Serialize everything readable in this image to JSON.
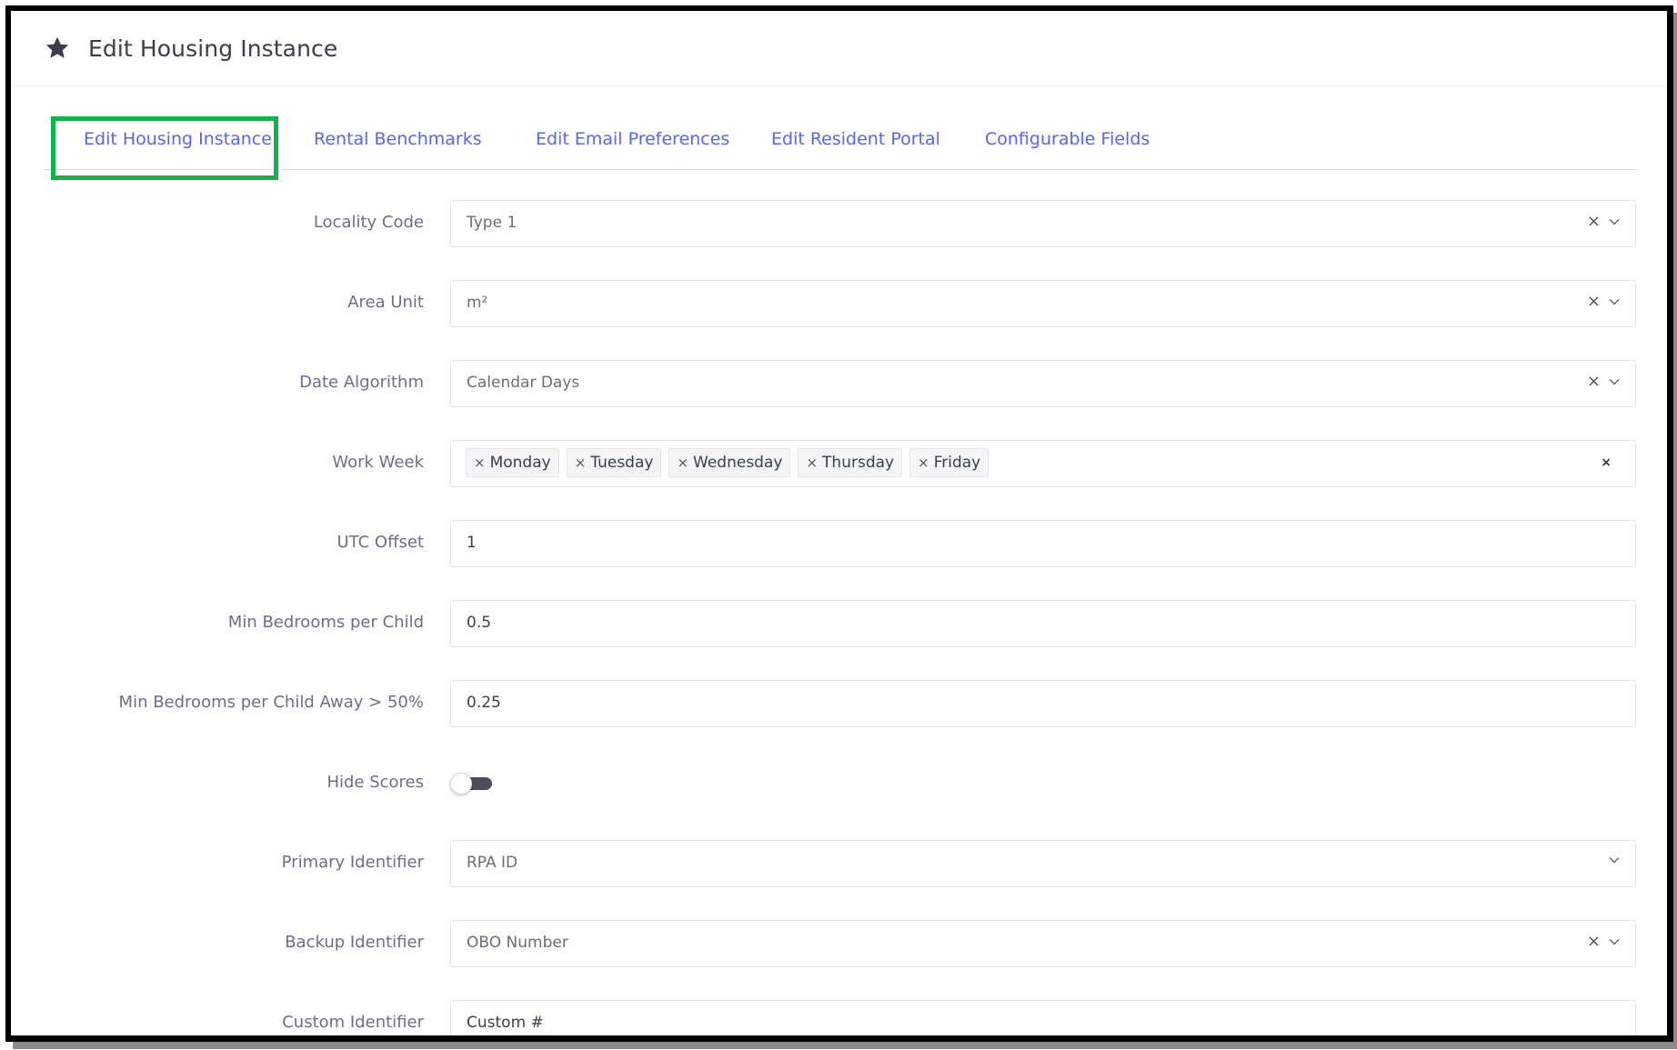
{
  "header": {
    "title": "Edit Housing Instance",
    "icon": "star-icon"
  },
  "tabs": [
    {
      "label": "Edit Housing Instance",
      "active": true
    },
    {
      "label": "Rental Benchmarks",
      "active": false
    },
    {
      "label": "Edit Email Preferences",
      "active": false
    },
    {
      "label": "Edit Resident Portal",
      "active": false
    },
    {
      "label": "Configurable Fields",
      "active": false
    }
  ],
  "form": {
    "locality_code": {
      "label": "Locality Code",
      "value": "Type 1"
    },
    "area_unit": {
      "label": "Area Unit",
      "value": "m²"
    },
    "date_algorithm": {
      "label": "Date Algorithm",
      "value": "Calendar Days"
    },
    "work_week": {
      "label": "Work Week",
      "tags": [
        "Monday",
        "Tuesday",
        "Wednesday",
        "Thursday",
        "Friday"
      ]
    },
    "utc_offset": {
      "label": "UTC Offset",
      "value": "1"
    },
    "min_bedrooms_child": {
      "label": "Min Bedrooms per Child",
      "value": "0.5"
    },
    "min_bedrooms_child_away": {
      "label": "Min Bedrooms per Child Away > 50%",
      "value": "0.25"
    },
    "hide_scores": {
      "label": "Hide Scores",
      "on": false
    },
    "primary_identifier": {
      "label": "Primary Identifier",
      "value": "RPA ID"
    },
    "backup_identifier": {
      "label": "Backup Identifier",
      "value": "OBO Number"
    },
    "custom_identifier": {
      "label": "Custom Identifier",
      "value": "Custom #"
    }
  },
  "glyphs": {
    "clear": "×",
    "tag_remove": "×",
    "tagbox_clear": "×"
  },
  "colors": {
    "tab_text": "#5a66e8",
    "active_tab_highlight": "#12b24a",
    "label_text": "#6a6f8c"
  }
}
